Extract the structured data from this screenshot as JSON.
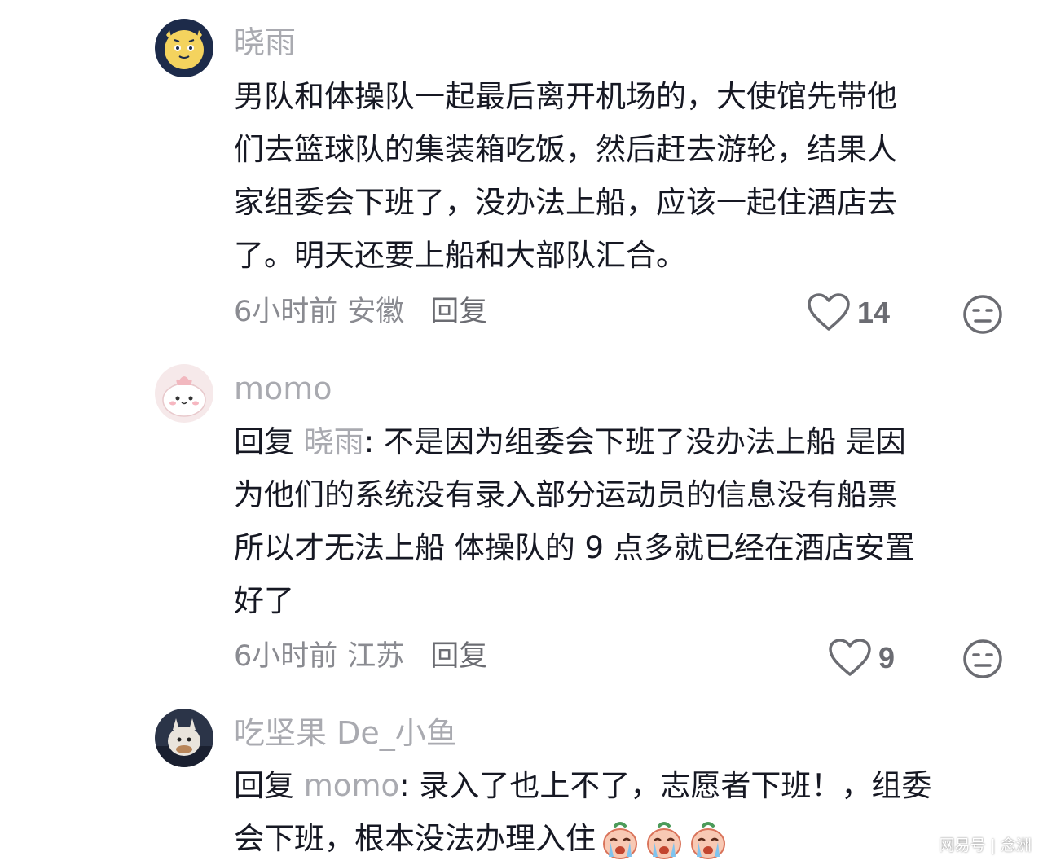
{
  "comments": [
    {
      "username": "晓雨",
      "avatar_icon": "cat-tiger-avatar-icon",
      "lines": [
        "男队和体操队一起最后离开机场的，大使馆先带他",
        "们去篮球队的集装箱吃饭，然后赶去游轮，结果人",
        "家组委会下班了，没办法上船，应该一起住酒店去",
        "了。明天还要上船和大部队汇合。"
      ],
      "time": "6小时前",
      "region": "安徽",
      "reply_label": "回复",
      "likes": "14"
    },
    {
      "username": "momo",
      "avatar_icon": "pink-bun-avatar-icon",
      "reply_prefix": "回复",
      "reply_target": "晓雨",
      "lines": [
        ": 不是因为组委会下班了没办法上船 是因",
        "为他们的系统没有录入部分运动员的信息没有船票",
        "所以才无法上船 体操队的 9 点多就已经在酒店安置",
        "好了"
      ],
      "time": "6小时前",
      "region": "江苏",
      "reply_label": "回复",
      "likes": "9"
    },
    {
      "username": "吃坚果 De_小鱼",
      "avatar_icon": "fluffy-creature-avatar-icon",
      "reply_prefix": "回复",
      "reply_target": "momo",
      "lines": [
        ": 录入了也上不了，志愿者下班！，组委",
        "会下班，根本没法办理入住"
      ],
      "emojis": [
        "crying-face-emoji",
        "crying-face-emoji",
        "crying-face-emoji"
      ]
    }
  ],
  "icons": {
    "like": "heart-outline-icon",
    "dislike": "meh-face-icon"
  },
  "colors": {
    "username": "#a9aab0",
    "text": "#161823",
    "meta": "#8a8b91"
  },
  "watermark": "网易号 | 念洲"
}
